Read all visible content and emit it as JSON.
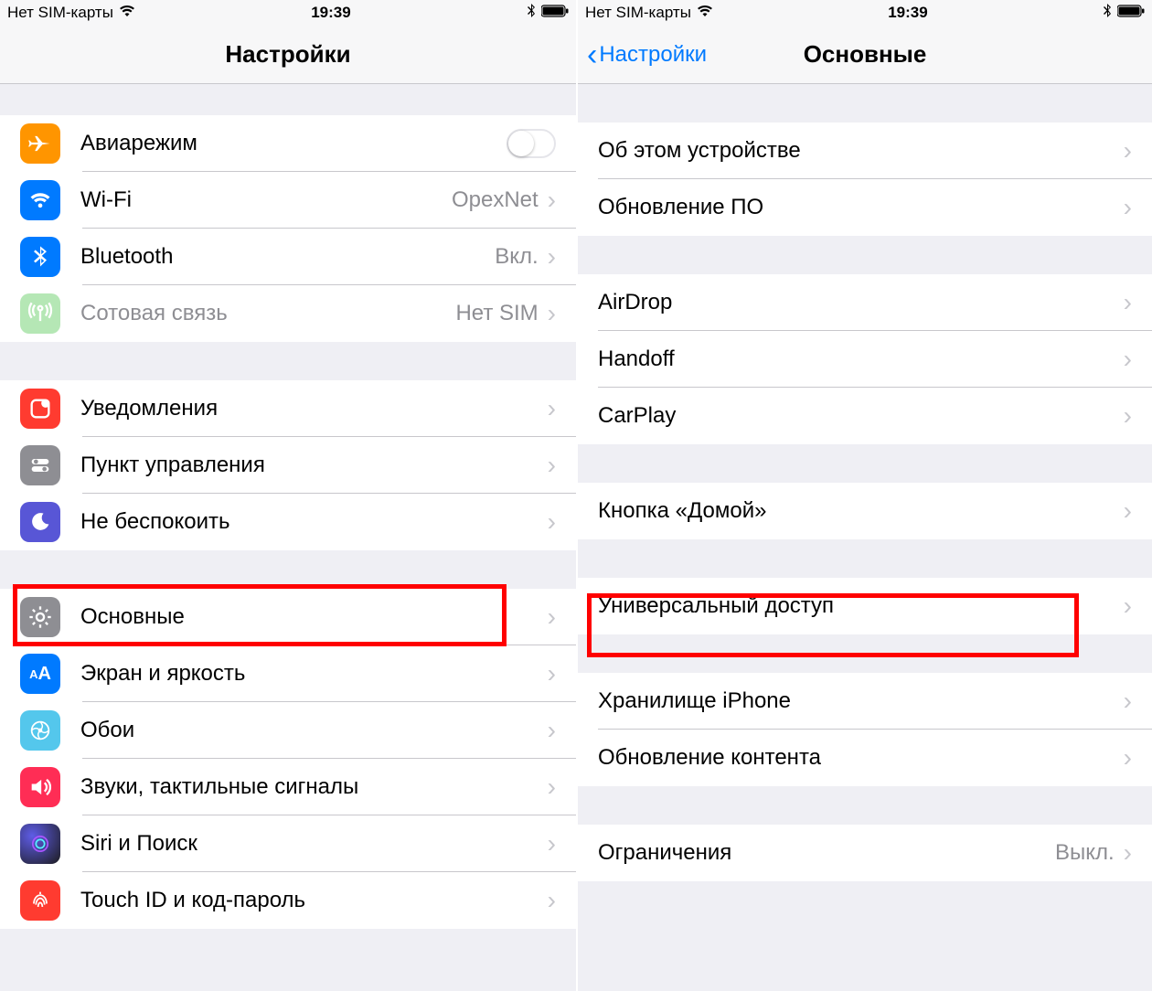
{
  "status": {
    "sim": "Нет SIM-карты",
    "time": "19:39"
  },
  "left": {
    "title": "Настройки",
    "rows": {
      "airplane": "Авиарежим",
      "wifi": "Wi-Fi",
      "wifi_value": "OpexNet",
      "bluetooth": "Bluetooth",
      "bluetooth_value": "Вкл.",
      "cellular": "Сотовая связь",
      "cellular_value": "Нет SIM",
      "notifications": "Уведомления",
      "control_center": "Пункт управления",
      "dnd": "Не беспокоить",
      "general": "Основные",
      "display": "Экран и яркость",
      "wallpaper": "Обои",
      "sounds": "Звуки, тактильные сигналы",
      "siri": "Siri и Поиск",
      "touchid": "Touch ID и код-пароль"
    }
  },
  "right": {
    "back": "Настройки",
    "title": "Основные",
    "rows": {
      "about": "Об этом устройстве",
      "update": "Обновление ПО",
      "airdrop": "AirDrop",
      "handoff": "Handoff",
      "carplay": "CarPlay",
      "home": "Кнопка «Домой»",
      "accessibility": "Универсальный доступ",
      "storage": "Хранилище iPhone",
      "background": "Обновление контента",
      "restrictions": "Ограничения",
      "restrictions_value": "Выкл."
    }
  },
  "icons": {
    "airplane": "airplane-icon",
    "wifi": "wifi-icon",
    "bluetooth": "bluetooth-icon",
    "cellular": "cellular-icon",
    "notifications": "notifications-icon",
    "control_center": "control-center-icon",
    "dnd": "dnd-icon",
    "general": "gear-icon",
    "display": "display-icon",
    "wallpaper": "wallpaper-icon",
    "sounds": "sounds-icon",
    "siri": "siri-icon",
    "touchid": "touchid-icon"
  },
  "colors": {
    "airplane": "#ff9500",
    "wifi": "#007aff",
    "bluetooth": "#007aff",
    "cellular": "#b5e7b5",
    "notifications": "#ff3b30",
    "control_center": "#8e8e93",
    "dnd": "#5856d6",
    "general": "#8e8e93",
    "display": "#007aff",
    "wallpaper": "#54c7ec",
    "sounds": "#ff2d55",
    "siri": "#1c1c1e",
    "touchid": "#ff3b30"
  }
}
